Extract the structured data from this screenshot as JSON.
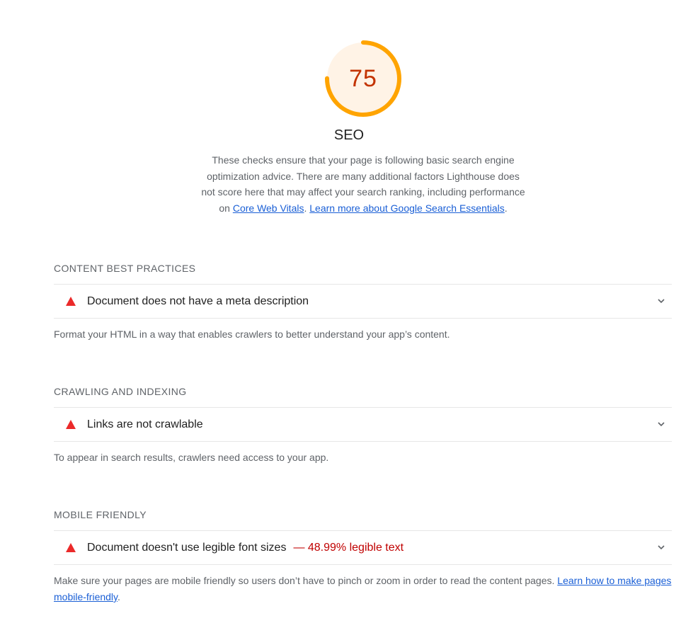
{
  "category": {
    "score": "75",
    "score_fraction": 0.75,
    "gauge_color": "#ffa400",
    "gauge_fill": "#fff3e6",
    "score_text_color": "#c33300",
    "title": "SEO",
    "description_text": "These checks ensure that your page is following basic search engine optimization advice. There are many additional factors Lighthouse does not score here that may affect your search ranking, including performance on ",
    "link_core_web_vitals": "Core Web Vitals",
    "separator": ". ",
    "link_learn_more": "Learn more about Google Search Essentials",
    "period": "."
  },
  "groups": [
    {
      "title": "CONTENT BEST PRACTICES",
      "audit": {
        "title": "Document does not have a meta description",
        "icon": "fail-triangle-icon"
      },
      "description": "Format your HTML in a way that enables crawlers to better understand your app’s content."
    },
    {
      "title": "CRAWLING AND INDEXING",
      "audit": {
        "title": "Links are not crawlable",
        "icon": "fail-triangle-icon"
      },
      "description": "To appear in search results, crawlers need access to your app."
    },
    {
      "title": "MOBILE FRIENDLY",
      "audit": {
        "title": "Document doesn't use legible font sizes",
        "value": "— 48.99% legible text",
        "icon": "fail-triangle-icon"
      },
      "description": "Make sure your pages are mobile friendly so users don’t have to pinch or zoom in order to read the content pages. ",
      "link": "Learn how to make pages mobile-friendly",
      "period": "."
    }
  ],
  "colors": {
    "fail": "#eb2a2a",
    "link": "#1a5fd6",
    "value_fail": "#c00000"
  }
}
